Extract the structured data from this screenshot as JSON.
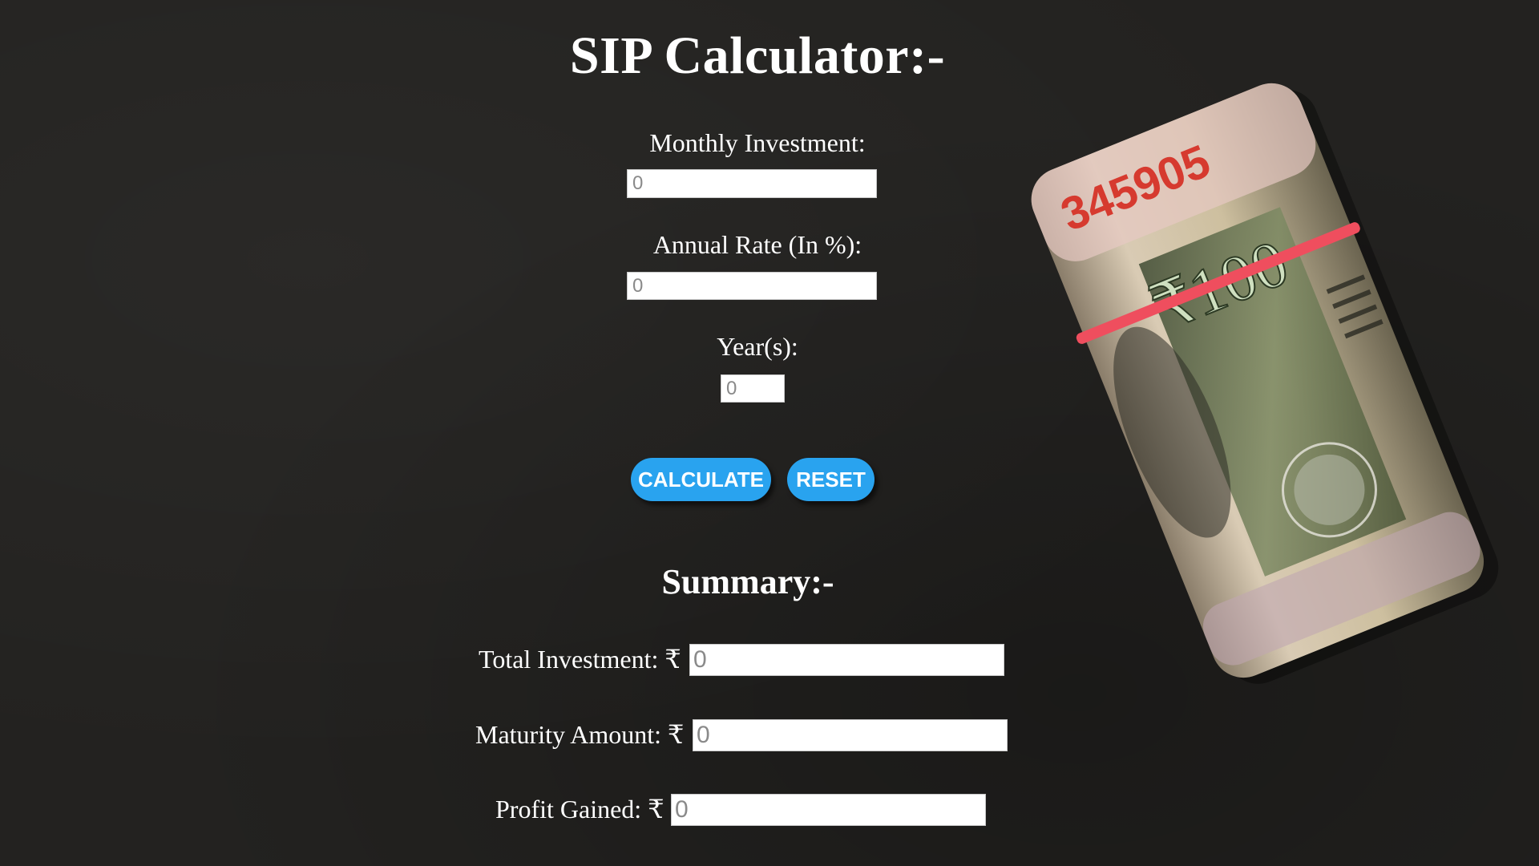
{
  "header": {
    "title": "SIP Calculator:-"
  },
  "form": {
    "monthly_investment": {
      "label": "Monthly Investment:",
      "placeholder": "0"
    },
    "annual_rate": {
      "label": "Annual Rate (In %):",
      "placeholder": "0"
    },
    "years": {
      "label": "Year(s):",
      "placeholder": "0"
    }
  },
  "buttons": {
    "calculate": "CALCULATE",
    "reset": "RESET"
  },
  "summary": {
    "title": "Summary:-",
    "total_investment": {
      "label": "Total Investment: ₹",
      "placeholder": "0"
    },
    "maturity_amount": {
      "label": "Maturity Amount: ₹",
      "placeholder": "0"
    },
    "profit_gained": {
      "label": "Profit Gained: ₹",
      "placeholder": "0"
    }
  },
  "image": {
    "name": "rolled-rupee-notes",
    "serial": "345905",
    "denomination": "₹100"
  },
  "colors": {
    "background": "#232220",
    "button": "#29a3ef",
    "text": "#ffffff"
  }
}
